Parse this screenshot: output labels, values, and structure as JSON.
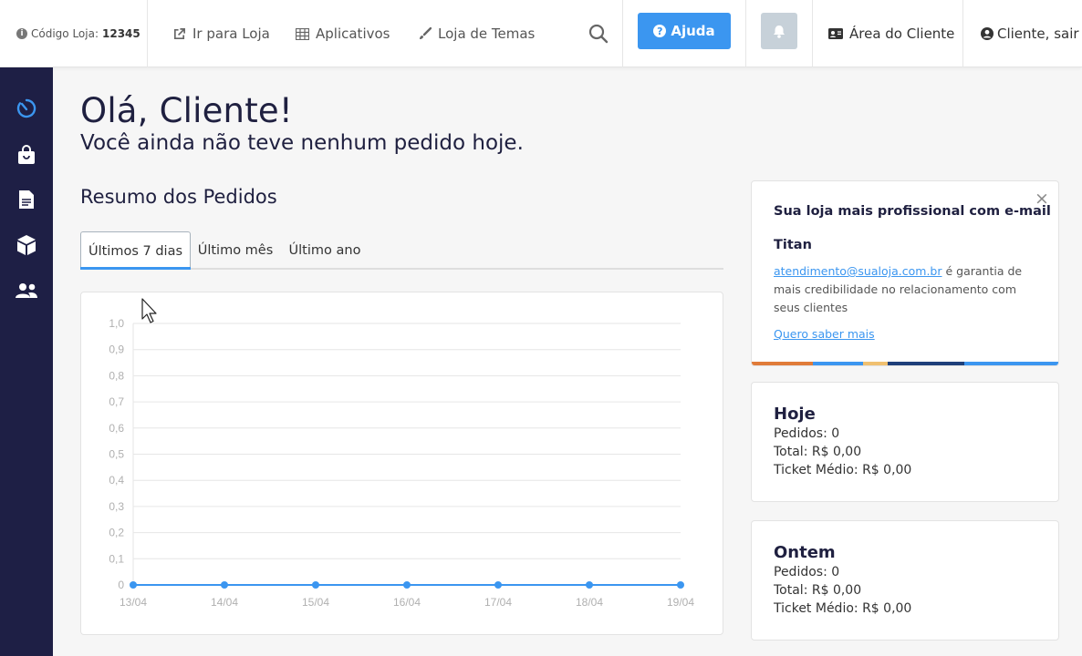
{
  "topbar": {
    "store_code_label": "Código Loja:",
    "store_code_value": "12345",
    "nav": [
      {
        "label": "Ir para Loja",
        "icon": "external-link-icon"
      },
      {
        "label": "Aplicativos",
        "icon": "grid-icon"
      },
      {
        "label": "Loja de Temas",
        "icon": "brush-icon"
      }
    ],
    "help_label": "Ajuda",
    "client_area_label": "Área do Cliente",
    "logout_label": "Cliente, sair"
  },
  "sidebar": {
    "items": [
      {
        "icon": "timer-icon",
        "active": true
      },
      {
        "icon": "shopping-bag-icon",
        "active": false
      },
      {
        "icon": "document-icon",
        "active": false
      },
      {
        "icon": "box-icon",
        "active": false
      },
      {
        "icon": "users-icon",
        "active": false
      }
    ]
  },
  "main": {
    "greeting": "Olá, Cliente!",
    "subtitle": "Você ainda não teve nenhum pedido hoje.",
    "section_title": "Resumo dos Pedidos",
    "tabs": [
      "Últimos 7 dias",
      "Último mês",
      "Último ano"
    ],
    "active_tab": 0
  },
  "chart_data": {
    "type": "line",
    "x": [
      "13/04",
      "14/04",
      "15/04",
      "16/04",
      "17/04",
      "18/04",
      "19/04"
    ],
    "series": [
      {
        "values": [
          0,
          0,
          0,
          0,
          0,
          0,
          0
        ],
        "color": "#3b96f0"
      }
    ],
    "ylim": [
      0,
      1
    ],
    "yticks": [
      "0",
      "0,1",
      "0,2",
      "0,3",
      "0,4",
      "0,5",
      "0,6",
      "0,7",
      "0,8",
      "0,9",
      "1,0"
    ],
    "grid": true
  },
  "promo": {
    "title": "Sua loja mais profissional com e-mail",
    "brand": "Titan",
    "email": "atendimento@sualoja.com.br",
    "text": " é garantia de mais credibilidade no relacionamento com seus clientes",
    "link": "Quero saber mais",
    "close": "×"
  },
  "stats": {
    "today": {
      "title": "Hoje",
      "orders": "Pedidos: 0",
      "total": "Total: R$ 0,00",
      "ticket": "Ticket Médio: R$ 0,00"
    },
    "yesterday": {
      "title": "Ontem",
      "orders": "Pedidos: 0",
      "total": "Total: R$ 0,00",
      "ticket": "Ticket Médio: R$ 0,00"
    }
  },
  "colors": {
    "accent": "#3b96f0",
    "sidebar": "#1e1f45",
    "stripe": [
      "#e07b39",
      "#3b96f0",
      "#f0c070",
      "#1e3f7a",
      "#3b96f0"
    ]
  }
}
